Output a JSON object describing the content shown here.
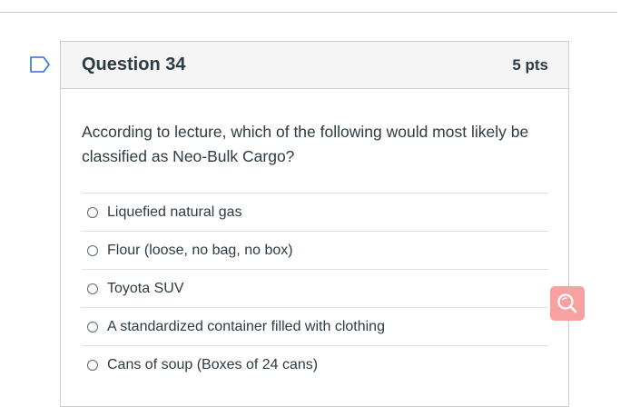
{
  "question": {
    "title": "Question 34",
    "points": "5 pts",
    "text": "According to lecture, which of the following would most likely be classified as Neo-Bulk Cargo?",
    "answers": [
      {
        "label": "Liquefied natural gas"
      },
      {
        "label": "Flour (loose, no bag, no box)"
      },
      {
        "label": "Toyota SUV"
      },
      {
        "label": "A standardized container filled with clothing"
      },
      {
        "label": "Cans of soup (Boxes of 24 cans)"
      }
    ]
  },
  "icons": {
    "flag": "flag-icon",
    "search": "search-icon"
  },
  "colors": {
    "flag_outline": "#2d6fdc",
    "search_widget_bg": "#f7a1a1",
    "text": "#2d3b45",
    "border": "#c7cdd1"
  }
}
